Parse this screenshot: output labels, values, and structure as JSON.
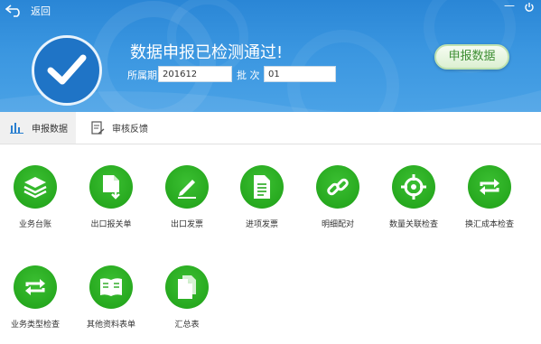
{
  "header": {
    "back_label": "返回",
    "minimize_glyph": "—",
    "status_title": "数据申报已检测通过!",
    "period_label": "所属期",
    "period_value": "201612",
    "batch_label": "批 次",
    "batch_value": "01",
    "submit_label": "申报数据"
  },
  "tabs": [
    {
      "label": "申报数据",
      "icon": "bar-chart-icon",
      "active": true
    },
    {
      "label": "审核反馈",
      "icon": "document-edit-icon",
      "active": false
    }
  ],
  "functions": [
    {
      "label": "业务台账",
      "icon": "layers-icon"
    },
    {
      "label": "出口报关单",
      "icon": "file-download-icon"
    },
    {
      "label": "出口发票",
      "icon": "pen-icon"
    },
    {
      "label": "进项发票",
      "icon": "document-lines-icon"
    },
    {
      "label": "明细配对",
      "icon": "link-icon"
    },
    {
      "label": "数量关联检查",
      "icon": "target-icon"
    },
    {
      "label": "换汇成本检查",
      "icon": "refresh-icon"
    },
    {
      "label": "业务类型检查",
      "icon": "refresh-icon"
    },
    {
      "label": "其他资料表单",
      "icon": "book-icon"
    },
    {
      "label": "汇总表",
      "icon": "copy-icon"
    }
  ],
  "colors": {
    "header_blue": "#2a86d6",
    "icon_green": "#27a91f",
    "submit_text": "#3f8f35"
  }
}
